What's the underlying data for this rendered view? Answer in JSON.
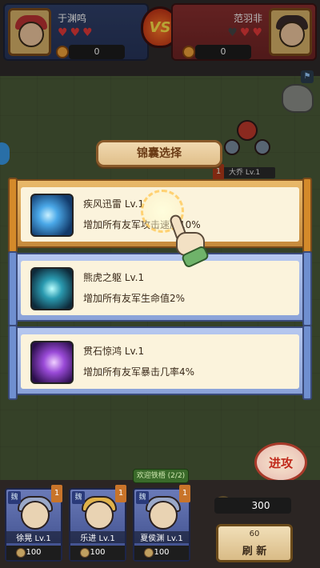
{
  "players": {
    "left": {
      "name": "于渊鸣",
      "hearts_full": 3,
      "hearts_total": 3,
      "gold": "0"
    },
    "right": {
      "name": "范羽非",
      "hearts_full": 2,
      "hearts_total": 3,
      "gold": "0"
    },
    "vs_label": "VS"
  },
  "enemy": {
    "level": "1",
    "label": "大乔 Lv.1"
  },
  "dialog": {
    "title": "锦囊选择",
    "cards": [
      {
        "name": "疾风迅雷 Lv.1",
        "desc": "增加所有友军攻击速度10%",
        "frame": "gold",
        "icon": "lightning-skill-icon"
      },
      {
        "name": "熊虎之躯 Lv.1",
        "desc": "增加所有友军生命值2%",
        "frame": "blue",
        "icon": "pillar-skill-icon"
      },
      {
        "name": "贯石惊鸿 Lv.1",
        "desc": "增加所有友军暴击几率4%",
        "frame": "blue",
        "icon": "slash-skill-icon"
      }
    ]
  },
  "welcome": "欢迎铁梧 (2/2)",
  "heroes": [
    {
      "faction": "魏",
      "level": "1",
      "name": "徐晃 Lv.1",
      "cost": "100"
    },
    {
      "faction": "魏",
      "level": "1",
      "name": "乐进 Lv.1",
      "cost": "100"
    },
    {
      "faction": "魏",
      "level": "1",
      "name": "夏侯渊 Lv.1",
      "cost": "100"
    }
  ],
  "coins": "300",
  "refresh": {
    "cost": "60",
    "label": "刷 新"
  },
  "attack_label": "进攻",
  "colors": {
    "gold_frame": "#c68a3c",
    "blue_frame": "#8aa2d8",
    "card_bg": "#fbf3dc"
  }
}
